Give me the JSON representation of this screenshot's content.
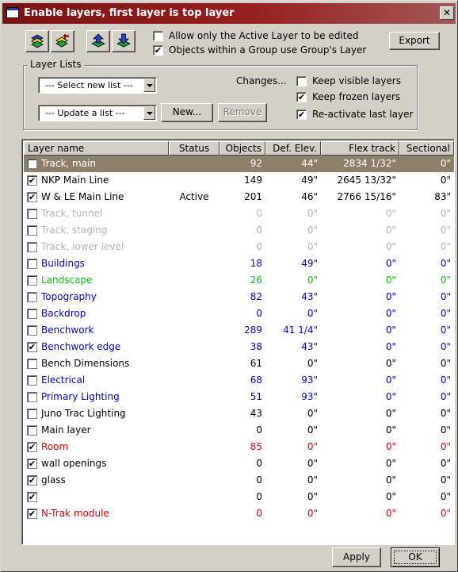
{
  "window": {
    "title": "Enable layers, first layer is top layer",
    "close_glyph": "✕",
    "title_colors": {
      "start": "#7a1212",
      "end": "#a35757"
    }
  },
  "toolbar": {
    "icon_buttons": [
      "layers-icon",
      "edit-layers-icon",
      "move-up-icon",
      "move-down-icon"
    ],
    "option_active_only": {
      "label": "Allow only the Active Layer to be edited",
      "checked": false
    },
    "option_group_layer": {
      "label": "Objects within a Group use Group's Layer",
      "checked": true
    },
    "export_label": "Export"
  },
  "layer_lists": {
    "title": "Layer Lists",
    "select_new_list": "--- Select new list ---",
    "update_a_list": "--- Update a list ---",
    "new_label": "New...",
    "remove_label": "Remove",
    "changes_label": "Changes...",
    "keep_visible": {
      "label": "Keep visible layers",
      "checked": false
    },
    "keep_frozen": {
      "label": "Keep frozen layers",
      "checked": true
    },
    "reactivate_last": {
      "label": "Re-activate last layer",
      "checked": true
    }
  },
  "table": {
    "columns": [
      "Layer name",
      "Status",
      "Objects",
      "Def. Elev.",
      "Flex track",
      "Sectional"
    ],
    "rows": [
      {
        "name": "Track, main",
        "checked": false,
        "status": "",
        "objects": "92",
        "elev": "44\"",
        "flex": "2834 1/32\"",
        "sectional": "0\"",
        "color": "#ffffff",
        "selected": true
      },
      {
        "name": "NKP Main Line",
        "checked": true,
        "status": "",
        "objects": "149",
        "elev": "49\"",
        "flex": "2645 13/32\"",
        "sectional": "0\"",
        "color": "#000000"
      },
      {
        "name": "W & LE Main Line",
        "checked": true,
        "status": "Active",
        "objects": "201",
        "elev": "46\"",
        "flex": "2766 15/16\"",
        "sectional": "83\"",
        "color": "#000000"
      },
      {
        "name": "Track, tunnel",
        "checked": false,
        "status": "",
        "objects": "0",
        "elev": "0\"",
        "flex": "0\"",
        "sectional": "0\"",
        "color": "#b4b4b4"
      },
      {
        "name": "Track, staging",
        "checked": false,
        "status": "",
        "objects": "0",
        "elev": "0\"",
        "flex": "0\"",
        "sectional": "0\"",
        "color": "#b4b4b4"
      },
      {
        "name": "Track, lower level",
        "checked": false,
        "status": "",
        "objects": "0",
        "elev": "0\"",
        "flex": "0\"",
        "sectional": "0\"",
        "color": "#b4b4b4"
      },
      {
        "name": "Buildings",
        "checked": false,
        "status": "",
        "objects": "18",
        "elev": "49\"",
        "flex": "0\"",
        "sectional": "0\"",
        "color": "#0000e0"
      },
      {
        "name": "Landscape",
        "checked": false,
        "status": "",
        "objects": "26",
        "elev": "0\"",
        "flex": "0\"",
        "sectional": "0\"",
        "color": "#00c800"
      },
      {
        "name": "Topography",
        "checked": false,
        "status": "",
        "objects": "82",
        "elev": "43\"",
        "flex": "0\"",
        "sectional": "0\"",
        "color": "#0000e0"
      },
      {
        "name": "Backdrop",
        "checked": false,
        "status": "",
        "objects": "0",
        "elev": "0\"",
        "flex": "0\"",
        "sectional": "0\"",
        "color": "#0000e0"
      },
      {
        "name": "Benchwork",
        "checked": false,
        "status": "",
        "objects": "289",
        "elev": "41 1/4\"",
        "flex": "0\"",
        "sectional": "0\"",
        "color": "#0000e0"
      },
      {
        "name": "Benchwork edge",
        "checked": true,
        "status": "",
        "objects": "38",
        "elev": "43\"",
        "flex": "0\"",
        "sectional": "0\"",
        "color": "#0000e0"
      },
      {
        "name": "Bench Dimensions",
        "checked": false,
        "status": "",
        "objects": "61",
        "elev": "0\"",
        "flex": "0\"",
        "sectional": "0\"",
        "color": "#000000"
      },
      {
        "name": "Electrical",
        "checked": false,
        "status": "",
        "objects": "68",
        "elev": "93\"",
        "flex": "0\"",
        "sectional": "0\"",
        "color": "#0000e0"
      },
      {
        "name": "Primary Lighting",
        "checked": false,
        "status": "",
        "objects": "51",
        "elev": "93\"",
        "flex": "0\"",
        "sectional": "0\"",
        "color": "#0000e0"
      },
      {
        "name": "Juno Trac Lighting",
        "checked": false,
        "status": "",
        "objects": "43",
        "elev": "0\"",
        "flex": "0\"",
        "sectional": "0\"",
        "color": "#000000"
      },
      {
        "name": "Main layer",
        "checked": false,
        "status": "",
        "objects": "0",
        "elev": "0\"",
        "flex": "0\"",
        "sectional": "0\"",
        "color": "#000000"
      },
      {
        "name": "Room",
        "checked": true,
        "status": "",
        "objects": "85",
        "elev": "0\"",
        "flex": "0\"",
        "sectional": "0\"",
        "color": "#e00000"
      },
      {
        "name": "wall openings",
        "checked": true,
        "status": "",
        "objects": "0",
        "elev": "0\"",
        "flex": "0\"",
        "sectional": "0\"",
        "color": "#000000"
      },
      {
        "name": "glass",
        "checked": true,
        "status": "",
        "objects": "0",
        "elev": "0\"",
        "flex": "0\"",
        "sectional": "0\"",
        "color": "#000000"
      },
      {
        "name": "",
        "checked": true,
        "status": "",
        "objects": "0",
        "elev": "0\"",
        "flex": "0\"",
        "sectional": "0\"",
        "color": "#000000"
      },
      {
        "name": "N-Trak module",
        "checked": true,
        "status": "",
        "objects": "0",
        "elev": "0\"",
        "flex": "0\"",
        "sectional": "0\"",
        "color": "#e00000"
      }
    ]
  },
  "footer": {
    "apply_label": "Apply",
    "ok_label": "OK"
  },
  "check_glyph": "✔"
}
